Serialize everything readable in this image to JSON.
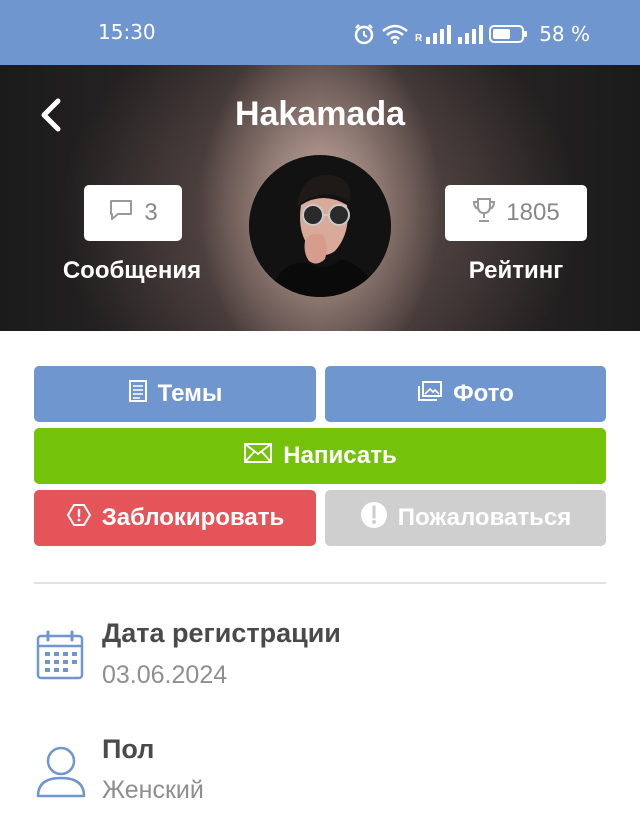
{
  "status_bar": {
    "time": "15:30",
    "battery": "58 %",
    "icons": [
      "alarm-icon",
      "wifi-icon",
      "signal-icon",
      "signal-icon",
      "battery-icon"
    ],
    "roaming_mark": "R"
  },
  "profile": {
    "name": "Hakamada",
    "messages_count": "3",
    "messages_label": "Сообщения",
    "rating_value": "1805",
    "rating_label": "Рейтинг"
  },
  "actions": {
    "topics_label": "Темы",
    "photo_label": "Фото",
    "write_label": "Написать",
    "block_label": "Заблокировать",
    "report_label": "Пожаловаться"
  },
  "info": {
    "registration_title": "Дата регистрации",
    "registration_value": "03.06.2024",
    "gender_title": "Пол",
    "gender_value": "Женский"
  },
  "colors": {
    "primary": "#6f96cf",
    "write": "#74c30a",
    "block": "#e55459",
    "report": "#cfcfcf"
  }
}
